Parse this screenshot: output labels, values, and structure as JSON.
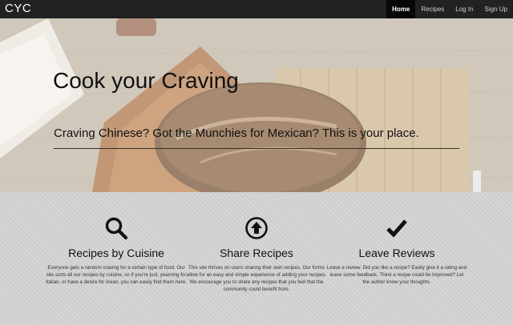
{
  "navbar": {
    "brand": "CYC",
    "links": [
      {
        "label": "Home",
        "active": true
      },
      {
        "label": "Recipes",
        "active": false
      },
      {
        "label": "Log In",
        "active": false
      },
      {
        "label": "Sign Up",
        "active": false
      }
    ]
  },
  "hero": {
    "title": "Cook your Craving",
    "subtitle": "Craving Chinese? Got the Munchies for Mexican? This is your place."
  },
  "features": [
    {
      "icon": "search-icon",
      "title": "Recipes by Cuisine",
      "text": "Everyone gets a random craving for a certain type of food. Our site sorts all our recipes by cuisine, so if you're just, yearning for Italian, or have a desire for Asian, you can easily find them here."
    },
    {
      "icon": "upload-circle-icon",
      "title": "Share Recipes",
      "text": "This site thrives on users sharing their own recipes. Our forms allow for an easy and simple experience of adding your recipes. We encourage you to share any recipes that you feel that the community could benefit from."
    },
    {
      "icon": "checkmark-icon",
      "title": "Leave Reviews",
      "text": "Leave a review. Did you like a recipe? Easily give it a rating and leave some feedback. Think a recipe could be improved? Let the author know your thoughts."
    }
  ],
  "colors": {
    "navbar_bg": "#222222",
    "navbar_active_bg": "#080808",
    "feature_bg": "#d4d4d4"
  }
}
